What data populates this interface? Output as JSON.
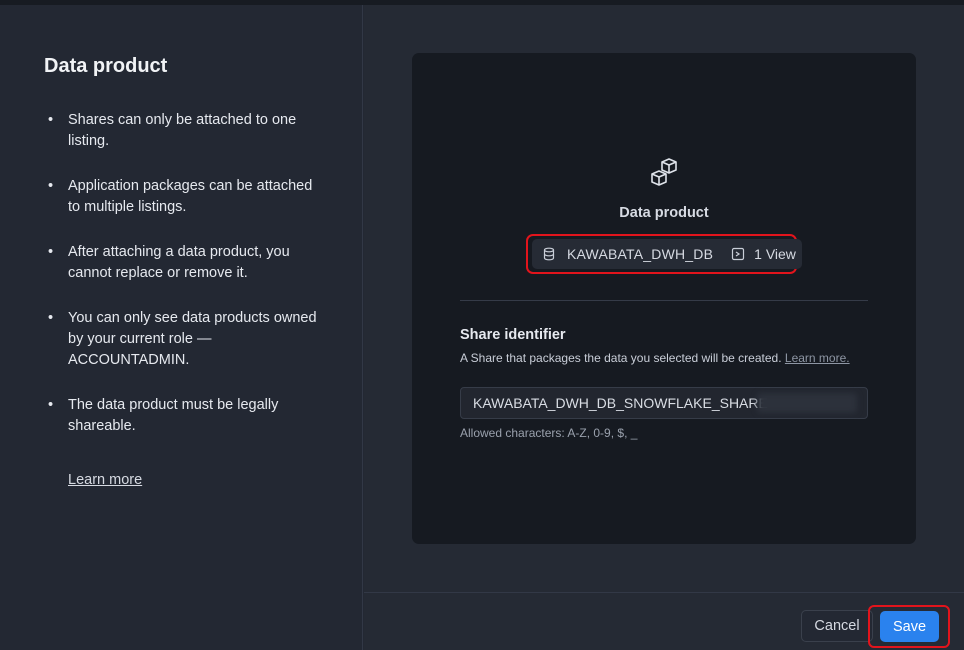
{
  "left": {
    "title": "Data product",
    "bullets": [
      "Shares can only be attached to one listing.",
      "Application packages can be attached to multiple listings.",
      "After attaching a data product, you cannot replace or remove it.",
      "You can only see data products owned by your current role — ACCOUNTADMIN.",
      "The data product must be legally shareable."
    ],
    "learn_more": "Learn more"
  },
  "card": {
    "icon": "data-product-cubes-icon",
    "label": "Data product",
    "chip": {
      "db_icon": "database-icon",
      "db_name": "KAWABATA_DWH_DB",
      "view_icon": "view-icon",
      "view_count": "1 View"
    },
    "share": {
      "title": "Share identifier",
      "description": "A Share that packages the data you selected will be created.",
      "description_link": "Learn more.",
      "value": "KAWABATA_DWH_DB_SNOWFLAKE_SHARE",
      "allowed": "Allowed characters: A-Z, 0-9, $, _"
    }
  },
  "footer": {
    "cancel": "Cancel",
    "save": "Save"
  },
  "colors": {
    "accent": "#2a82ee",
    "highlight": "#e2141c"
  }
}
